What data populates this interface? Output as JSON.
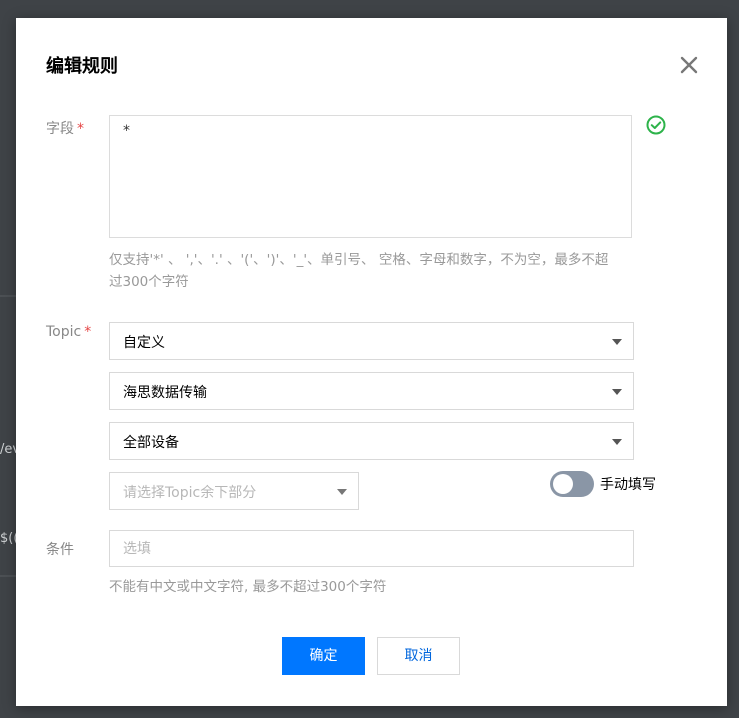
{
  "background": {
    "fragment_1": "/ev",
    "fragment_2": "$(("
  },
  "dialog": {
    "title": "编辑规则",
    "close_icon": "close-icon"
  },
  "field": {
    "label": "字段",
    "required_mark": "*",
    "value": "*",
    "status_icon": "check-circle-icon",
    "status_color": "#2db34a",
    "hint_line1": "仅支持'*' 、 ','、'.' 、'('、')'、'_'、单引号、 空格、字母和数字，不为空，最多不超",
    "hint_line2": "过300个字符"
  },
  "topic": {
    "label": "Topic",
    "required_mark": "*",
    "select_1": "自定义",
    "select_2": "海思数据传输",
    "select_3": "全部设备",
    "select_4_placeholder": "请选择Topic余下部分",
    "toggle_label": "手动填写",
    "toggle_on": false
  },
  "condition": {
    "label": "条件",
    "placeholder": "选填",
    "hint": "不能有中文或中文字符, 最多不超过300个字符"
  },
  "footer": {
    "confirm_label": "确定",
    "cancel_label": "取消",
    "accent_color": "#0077ff"
  }
}
